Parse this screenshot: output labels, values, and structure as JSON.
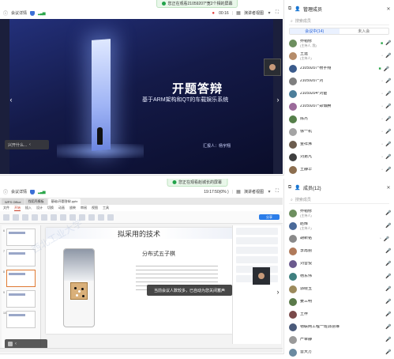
{
  "top": {
    "banner": "您正在观看21059207*宽2个相的屏幕",
    "toolbar": {
      "meeting_details": "会议详情",
      "timer": "00:16",
      "layout_label": "演讲者视图",
      "exit_icon": "exit-fullscreen-icon"
    },
    "slide": {
      "title": "开题答辩",
      "subtitle": "基于ARM架构和QT的车载娱乐系统",
      "reporter": "汇报人：杨宇翔",
      "self_label": "兴开什么..."
    },
    "panel": {
      "title": "管理成员",
      "search_placeholder": "搜索成员",
      "tabs": [
        "会议中(14)",
        "未入会"
      ],
      "members": [
        {
          "name": "乔帽修",
          "role": "(主持人, 我)",
          "mic": "off",
          "cam": "on"
        },
        {
          "name": "王运",
          "role": "(主持人)",
          "mic": "off",
          "cam": "off"
        },
        {
          "name": "21059207*杨宇翔",
          "role": "",
          "mic": "on",
          "cam": "on"
        },
        {
          "name": "21059207*刘",
          "role": "",
          "mic": "off",
          "cam": "off"
        },
        {
          "name": "21059204*刘爸",
          "role": "",
          "mic": "off",
          "cam": "off"
        },
        {
          "name": "21059207*郑博腾",
          "role": "",
          "mic": "off",
          "cam": "off"
        },
        {
          "name": "陈杰",
          "role": "",
          "mic": "off",
          "cam": "off"
        },
        {
          "name": "徐一机",
          "role": "",
          "mic": "off",
          "cam": "off"
        },
        {
          "name": "金祥沸",
          "role": "",
          "mic": "off",
          "cam": "off"
        },
        {
          "name": "刘弟凡",
          "role": "",
          "mic": "off",
          "cam": "off"
        },
        {
          "name": "王静华",
          "role": "",
          "mic": "off",
          "cam": "off"
        }
      ]
    }
  },
  "bottom": {
    "banner": "您正在观看赵城长的屏幕",
    "toolbar": {
      "meeting_details": "会议详情",
      "timer": "19:17:50(0% )",
      "layout_label": "演讲者视图"
    },
    "wps": {
      "tabs": [
        "WPS Office",
        "找稻壳模板",
        "基础/开题答辩.pptx"
      ],
      "menu": [
        "文件",
        "开始",
        "插入",
        "设计",
        "切换",
        "动画",
        "放映",
        "审阅",
        "视图",
        "工具"
      ],
      "active_menu": "开始",
      "share_label": "分享",
      "slide_header": "拟采用的技术",
      "slide_h2": "分布式五子棋",
      "watermark": "西北工业大学"
    },
    "toast": "当前会议人数较多，已自动为您关闭蓄声",
    "panel": {
      "title": "成员(12)",
      "search_placeholder": "搜索成员",
      "members": [
        {
          "name": "乔帽修",
          "role": "(主持人)",
          "mic": "off"
        },
        {
          "name": "赵辉",
          "role": "(主持人)",
          "mic": "off"
        },
        {
          "name": "胡新铭",
          "role": "",
          "mic": "on"
        },
        {
          "name": "李再丽",
          "role": "",
          "mic": "off"
        },
        {
          "name": "刘音悦",
          "role": "",
          "mic": "off"
        },
        {
          "name": "杨东伟",
          "role": "",
          "mic": "off"
        },
        {
          "name": "郭晓玉",
          "role": "",
          "mic": "off"
        },
        {
          "name": "姜三明",
          "role": "",
          "mic": "off"
        },
        {
          "name": "王梓",
          "role": "",
          "mic": "off"
        },
        {
          "name": "物联网工程一班郭慧琳",
          "role": "",
          "mic": "off"
        },
        {
          "name": "严幸静",
          "role": "",
          "mic": "off"
        },
        {
          "name": "雷大方",
          "role": "",
          "mic": "off"
        }
      ]
    }
  }
}
